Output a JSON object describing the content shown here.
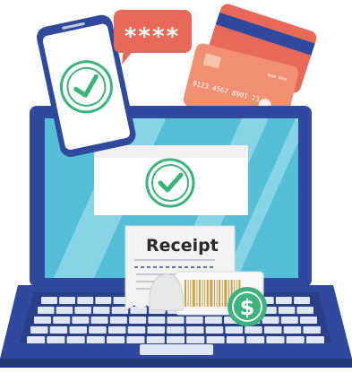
{
  "colors": {
    "laptop_frame": "#2f4a9c",
    "laptop_frame_dark": "#22377a",
    "screen_bg": "#55bfd7",
    "screen_stripe": "#8dd7e8",
    "keyboard_bg": "#2a3f89",
    "key": "#dfe6f4",
    "phone_body": "#2f4a9c",
    "phone_screen": "#ffffff",
    "check_green": "#3cb37a",
    "speech_bubble": "#e8685a",
    "card_back": "#e8685a",
    "card_front": "#f08f72",
    "card_stripe": "#2f4a9c",
    "receipt_paper": "#f3f3f3",
    "dollar_badge": "#3cb37a",
    "barcode": "#c9a24a"
  },
  "speech_bubble": {
    "text": "****"
  },
  "card": {
    "number": "0123 4567 8901 23",
    "label_top": "0000 0000"
  },
  "receipt": {
    "title": "Receipt"
  },
  "dollar_badge": {
    "symbol": "$"
  },
  "icons": [
    "check-circle-icon",
    "dollar-icon",
    "barcode-icon"
  ]
}
